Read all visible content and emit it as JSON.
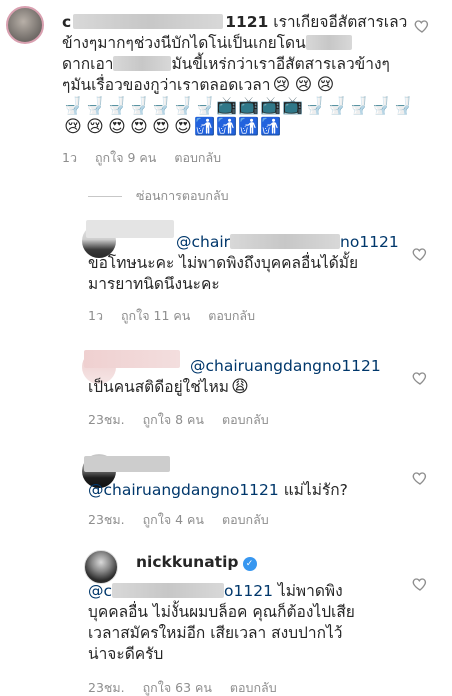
{
  "comments": [
    {
      "user_visible": "c",
      "user_suffix": "1121",
      "line1": "เราเกียจอีสัตสารเลว",
      "line2a": "ข้างๆมากๆช่วงนีบักไดโน่เป็นเกยโดน",
      "line2b": "",
      "line3a": "ดากเอา",
      "line3b": "มันขี้เหร่กว่าเราอีสัตสารเลวข้างๆ",
      "line4": "ๆมันเรื่อวของกูว่าเราตลอดเวลา",
      "emoji_row1": [
        "🚽",
        "🚽",
        "🚽",
        "🚽",
        "🚽",
        "🚽",
        "😢",
        "😢",
        "😢"
      ],
      "emoji_row2": [
        "🚽",
        "📺",
        "📺",
        "📺",
        "📺",
        "🚽",
        "🚽",
        "🚽",
        "🚽",
        "🚽"
      ],
      "emoji_row3": [
        "😢",
        "😢",
        "😍",
        "😍",
        "😍",
        "😍",
        "🚮",
        "🚮",
        "🚮",
        "🚮"
      ],
      "time": "1ว",
      "likes": "ถูกใจ 9 คน",
      "reply": "ตอบกลับ"
    },
    {
      "mention_prefix": "@chair",
      "mention_suffix": "no1121",
      "line1": "ขอโทษนะคะ ไม่พาดพิงถึงบุคคลอื่นได้มั้ย",
      "line2": "มารยาทนิดนึงนะคะ",
      "time": "1ว",
      "likes": "ถูกใจ 11 คน",
      "reply": "ตอบกลับ"
    },
    {
      "mention": "@chairuangdangno1121",
      "line1": "เป็นคนสติดีอยู่ใช่ไหม",
      "emoji": "😩",
      "time": "23ชม.",
      "likes": "ถูกใจ 8 คน",
      "reply": "ตอบกลับ"
    },
    {
      "mention": "@chairuangdangno1121",
      "text": " แม่ไม่รัก?",
      "time": "23ชม.",
      "likes": "ถูกใจ 4 คน",
      "reply": "ตอบกลับ"
    },
    {
      "username": "nickkunatip",
      "mention_prefix": "@c",
      "mention_suffix": "o1121",
      "line1": " ไม่พาดพิง",
      "line2": "บุคคลอื่น ไม่งั้นผมบล็อค คุณก็ต้องไปเสีย",
      "line3": "เวลาสมัครใหม่อีก เสียเวลา สงบปากไว้",
      "line4": "น่าจะดีครับ",
      "time": "23ชม.",
      "likes": "ถูกใจ 63 คน",
      "reply": "ตอบกลับ"
    }
  ],
  "hide_replies": "ซ่อนการตอบกลับ",
  "colors": {
    "text": "#262626",
    "meta": "#8e8e8e",
    "mention": "#00376b",
    "verified": "#3897f0"
  }
}
